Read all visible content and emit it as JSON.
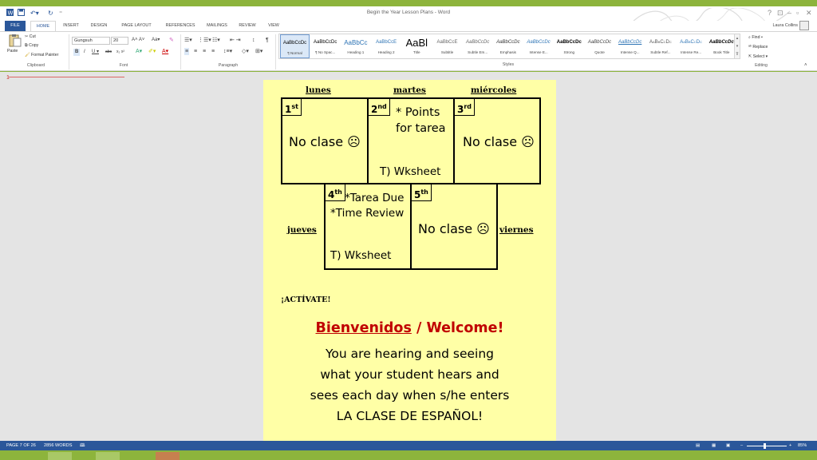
{
  "window": {
    "title": "Begin the Year Lesson Plans - Word",
    "user": "Laura Collins",
    "help": "?"
  },
  "tabs": [
    "FILE",
    "HOME",
    "INSERT",
    "DESIGN",
    "PAGE LAYOUT",
    "REFERENCES",
    "MAILINGS",
    "REVIEW",
    "VIEW"
  ],
  "clipboard": {
    "paste": "Paste",
    "cut": "Cut",
    "copy": "Copy",
    "format_painter": "Format Painter",
    "label": "Clipboard"
  },
  "font": {
    "family": "Gungsuh",
    "size": "20",
    "label": "Font"
  },
  "paragraph": {
    "label": "Paragraph"
  },
  "styles": {
    "label": "Styles",
    "items": [
      {
        "preview": "AaBbCcDc",
        "name": "¶ Normal"
      },
      {
        "preview": "AaBbCcDc",
        "name": "¶ No Spac..."
      },
      {
        "preview": "AaBbCc",
        "name": "Heading 1"
      },
      {
        "preview": "AaBbCcE",
        "name": "Heading 2"
      },
      {
        "preview": "AaBl",
        "name": "Title"
      },
      {
        "preview": "AaBbCcE",
        "name": "Subtitle"
      },
      {
        "preview": "AaBbCcDc",
        "name": "Subtle Em..."
      },
      {
        "preview": "AaBbCcDc",
        "name": "Emphasis"
      },
      {
        "preview": "AaBbCcDc",
        "name": "Intense E..."
      },
      {
        "preview": "AaBbCcDc",
        "name": "Strong"
      },
      {
        "preview": "AaBbCcDc",
        "name": "Quote"
      },
      {
        "preview": "AaBbCcDc",
        "name": "Intense Q..."
      },
      {
        "preview": "AaBbCcDc",
        "name": "Subtle Ref..."
      },
      {
        "preview": "AaBbCcDc",
        "name": "Intense Re..."
      },
      {
        "preview": "AaBbCcDc",
        "name": "Book Title"
      }
    ]
  },
  "editing": {
    "find": "Find",
    "replace": "Replace",
    "select": "Select",
    "label": "Editing"
  },
  "document": {
    "days_top": [
      "lunes",
      "martes",
      "miércoles"
    ],
    "day_left": "jueves",
    "day_right": "viernes",
    "cells": {
      "c1": {
        "num": "1",
        "sup": "st",
        "text": "No clase ☹"
      },
      "c2": {
        "num": "2",
        "sup": "nd",
        "line1": "* Points",
        "line2": "for tarea",
        "bottom": "T) Wksheet"
      },
      "c3": {
        "num": "3",
        "sup": "rd",
        "text": "No clase ☹"
      },
      "c4": {
        "num": "4",
        "sup": "th",
        "line1": "*Tarea Due",
        "line2": "*Time Review",
        "bottom": "T) Wksheet"
      },
      "c5": {
        "num": "5",
        "sup": "th",
        "text": "No clase ☹"
      }
    },
    "activate": "¡ACTÍVATE!",
    "welcome_es": "Bienvenidos",
    "welcome_sep": " / ",
    "welcome_en": "Welcome!",
    "paragraph_lines": [
      "You are hearing and seeing",
      "what your student hears and",
      "sees each day when s/he enters",
      "LA CLASE DE ESPAÑOL!"
    ]
  },
  "status": {
    "page": "PAGE 7 OF 26",
    "words": "2856 WORDS",
    "zoom": "85%"
  },
  "colors": {
    "accent": "#2b579a",
    "frame": "#8db43c",
    "page": "#ffffa6",
    "welcome": "#c00000"
  }
}
